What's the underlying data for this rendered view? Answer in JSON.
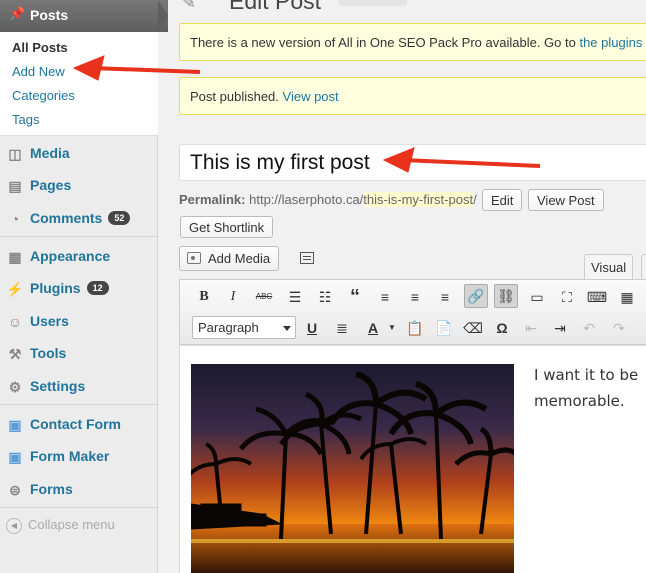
{
  "sidebar": {
    "posts_header": "Posts",
    "posts_submenu": [
      "All Posts",
      "Add New",
      "Categories",
      "Tags"
    ],
    "menu": [
      {
        "label": "Media",
        "icon": "media-icon",
        "glyph": "◫"
      },
      {
        "label": "Pages",
        "icon": "pages-icon",
        "glyph": "▤"
      },
      {
        "label": "Comments",
        "icon": "comments-icon",
        "glyph": "◔",
        "badge": "52"
      },
      {
        "label": "Appearance",
        "icon": "appearance-icon",
        "glyph": "▦"
      },
      {
        "label": "Plugins",
        "icon": "plugins-icon",
        "glyph": "⚡",
        "badge": "12"
      },
      {
        "label": "Users",
        "icon": "users-icon",
        "glyph": "☺"
      },
      {
        "label": "Tools",
        "icon": "tools-icon",
        "glyph": "⚒"
      },
      {
        "label": "Settings",
        "icon": "settings-icon",
        "glyph": "⚙"
      },
      {
        "label": "Contact Form",
        "icon": "contact-form-icon",
        "glyph": "▣"
      },
      {
        "label": "Form Maker",
        "icon": "form-maker-icon",
        "glyph": "▣"
      },
      {
        "label": "Forms",
        "icon": "forms-icon",
        "glyph": "⊜"
      }
    ],
    "collapse_label": "Collapse menu"
  },
  "header": {
    "title": "Edit Post"
  },
  "notices": {
    "update_text": "There is a new version of All in One SEO Pack Pro available. Go to ",
    "update_link": "the plugins",
    "published_text": "Post published. ",
    "published_link": "View post"
  },
  "post": {
    "title": "This is my first post",
    "permalink_label": "Permalink:",
    "permalink_base": "http://laserphoto.ca/",
    "permalink_slug": "this-is-my-first-post",
    "permalink_trail": "/",
    "edit_button": "Edit",
    "view_post_button": "View Post",
    "shortlink_button": "Get Shortlink",
    "add_media_button": "Add Media",
    "tab_visual": "Visual",
    "format_select": "Paragraph",
    "body_text": "I want it to be memorable."
  },
  "colors": {
    "link": "#21759b",
    "notice_bg": "#ffffe0",
    "annotation_arrow": "#e8321c"
  }
}
